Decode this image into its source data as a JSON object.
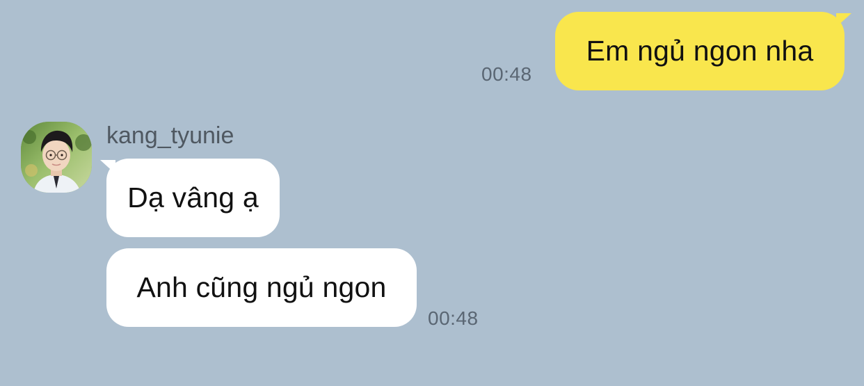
{
  "conversation": {
    "outgoing": [
      {
        "text": "Em ngủ ngon nha",
        "time": "00:48"
      }
    ],
    "incoming": {
      "sender": "kang_tyunie",
      "avatar_icon": "user-avatar-photo",
      "messages": [
        {
          "text": "Dạ vâng ạ"
        },
        {
          "text": "Anh cũng ngủ ngon"
        }
      ],
      "time": "00:48"
    }
  },
  "colors": {
    "background": "#adbfcf",
    "outgoing_bubble": "#f9e64d",
    "incoming_bubble": "#ffffff",
    "timestamp": "#5a6673",
    "sender_name": "#4f5861"
  }
}
